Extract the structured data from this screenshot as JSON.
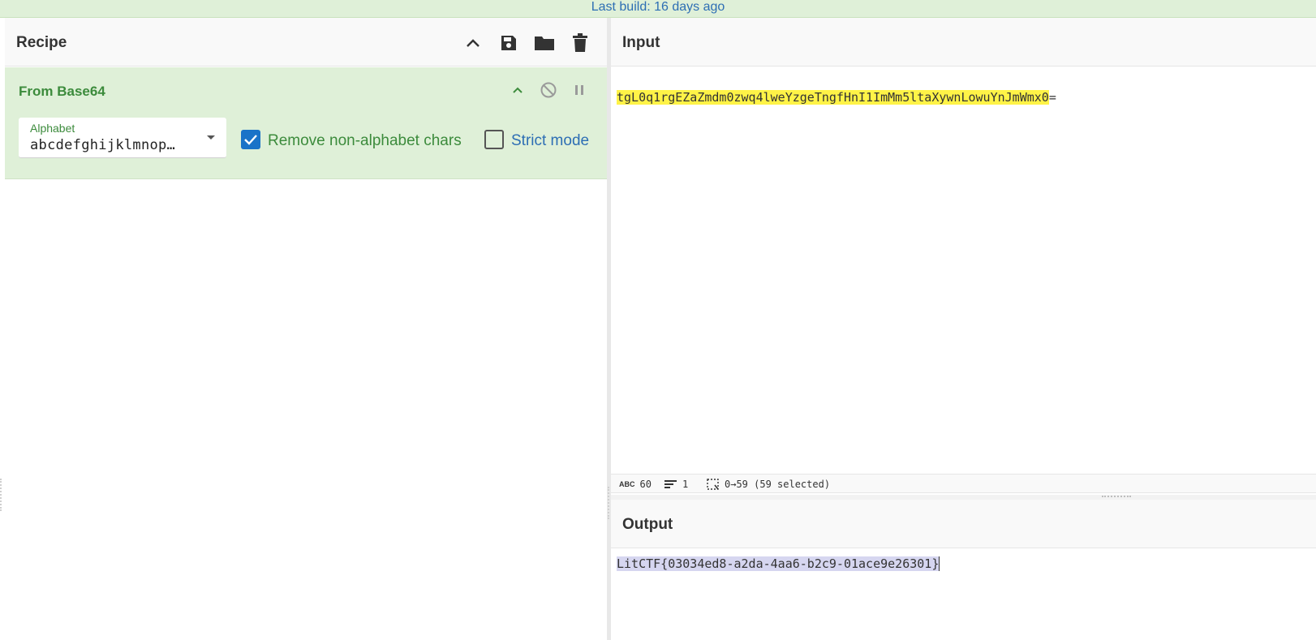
{
  "banner": {
    "text": "Last build: 16 days ago"
  },
  "recipe": {
    "title": "Recipe",
    "icons": [
      "chevron-up-icon",
      "save-icon",
      "folder-icon",
      "trash-icon"
    ]
  },
  "operation": {
    "title": "From Base64",
    "icons": [
      "chevron-up-icon",
      "disable-icon",
      "pause-icon"
    ],
    "alphabet": {
      "label": "Alphabet",
      "value": "abcdefghijklmnop…"
    },
    "remove_non_alphabet": {
      "label": "Remove non-alphabet chars",
      "checked": true
    },
    "strict_mode": {
      "label": "Strict mode",
      "checked": false
    }
  },
  "input": {
    "title": "Input",
    "selected_text": "tgL0q1rgEZaZmdm0zwq4lweYzgeTngfHnI1ImMm5ltaXywnLowuYnJmWmx0",
    "rest_text": "=",
    "status": {
      "length": "60",
      "lines": "1",
      "selection": "0→59 (59 selected)"
    }
  },
  "output": {
    "title": "Output",
    "text": "LitCTF{03034ed8-a2da-4aa6-b2c9-01ace9e26301}"
  },
  "colors": {
    "accent_green": "#3c8b3c",
    "accent_blue": "#2d6eb4",
    "op_background": "#dff0d8"
  }
}
